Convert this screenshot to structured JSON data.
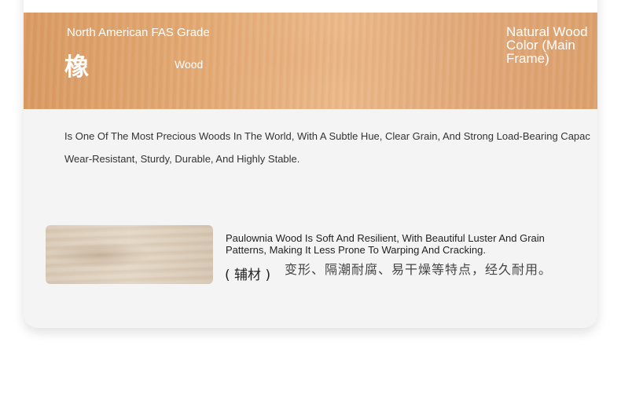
{
  "banner": {
    "grade": "North American FAS Grade",
    "character": "橡",
    "wood": "Wood",
    "natural_color": "Natural Wood Color (Main Frame)"
  },
  "description": {
    "line1": "Is One Of The Most Precious Woods In The World, With A Subtle Hue, Clear Grain, And Strong Load-Bearing Capac",
    "line2": "Wear-Resistant, Sturdy, Durable, And Highly Stable."
  },
  "auxiliary": {
    "english": "Paulownia Wood Is Soft And Resilient, With Beautiful Luster And Grain Patterns, Making It Less Prone To Warping And Cracking.",
    "label": "( 辅材 )",
    "chinese": "变形、隔潮耐腐、易干燥等特点，经久耐用。"
  }
}
